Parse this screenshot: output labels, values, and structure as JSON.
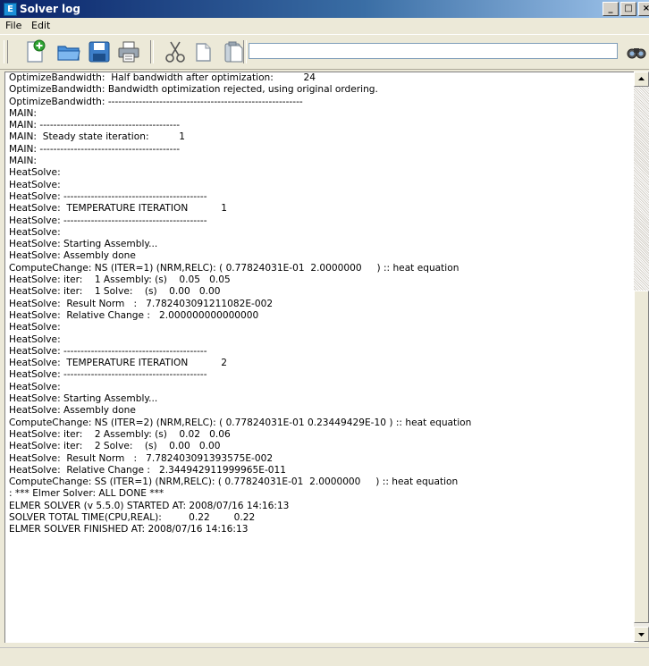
{
  "window": {
    "title": "Solver log",
    "app_icon_letter": "E"
  },
  "title_buttons": {
    "minimize": "_",
    "maximize": "□",
    "close": "×"
  },
  "menu": [
    "File",
    "Edit"
  ],
  "toolbar": {
    "icons": [
      "new-document-icon",
      "open-folder-icon",
      "save-icon",
      "print-icon",
      "cut-icon",
      "copy-icon",
      "paste-icon"
    ],
    "search_value": "",
    "find_icon": "binoculars-icon"
  },
  "log": {
    "lines": [
      "OptimizeBandwidth:  Half bandwidth after optimization:          24",
      "OptimizeBandwidth: Bandwidth optimization rejected, using original ordering.",
      "OptimizeBandwidth: ---------------------------------------------------------",
      "MAIN:",
      "MAIN: -----------------------------------------",
      "MAIN:  Steady state iteration:          1",
      "MAIN: -----------------------------------------",
      "MAIN:",
      "HeatSolve:",
      "HeatSolve:",
      "HeatSolve: ------------------------------------------",
      "HeatSolve:  TEMPERATURE ITERATION           1",
      "HeatSolve: ------------------------------------------",
      "HeatSolve:",
      "HeatSolve: Starting Assembly...",
      "HeatSolve: Assembly done",
      "ComputeChange: NS (ITER=1) (NRM,RELC): ( 0.77824031E-01  2.0000000     ) :: heat equation",
      "HeatSolve: iter:    1 Assembly: (s)    0.05   0.05",
      "HeatSolve: iter:    1 Solve:    (s)    0.00   0.00",
      "HeatSolve:  Result Norm   :   7.782403091211082E-002",
      "HeatSolve:  Relative Change :   2.000000000000000",
      "HeatSolve:",
      "HeatSolve:",
      "HeatSolve: ------------------------------------------",
      "HeatSolve:  TEMPERATURE ITERATION           2",
      "HeatSolve: ------------------------------------------",
      "HeatSolve:",
      "HeatSolve: Starting Assembly...",
      "HeatSolve: Assembly done",
      "ComputeChange: NS (ITER=2) (NRM,RELC): ( 0.77824031E-01 0.23449429E-10 ) :: heat equation",
      "HeatSolve: iter:    2 Assembly: (s)    0.02   0.06",
      "HeatSolve: iter:    2 Solve:    (s)    0.00   0.00",
      "HeatSolve:  Result Norm   :   7.782403091393575E-002",
      "HeatSolve:  Relative Change :   2.344942911999965E-011",
      "ComputeChange: SS (ITER=1) (NRM,RELC): ( 0.77824031E-01  2.0000000     ) :: heat equation",
      ": *** Elmer Solver: ALL DONE ***",
      "ELMER SOLVER (v 5.5.0) STARTED AT: 2008/07/16 14:16:13",
      "SOLVER TOTAL TIME(CPU,REAL):         0.22        0.22",
      "ELMER SOLVER FINISHED AT: 2008/07/16 14:16:13"
    ]
  }
}
